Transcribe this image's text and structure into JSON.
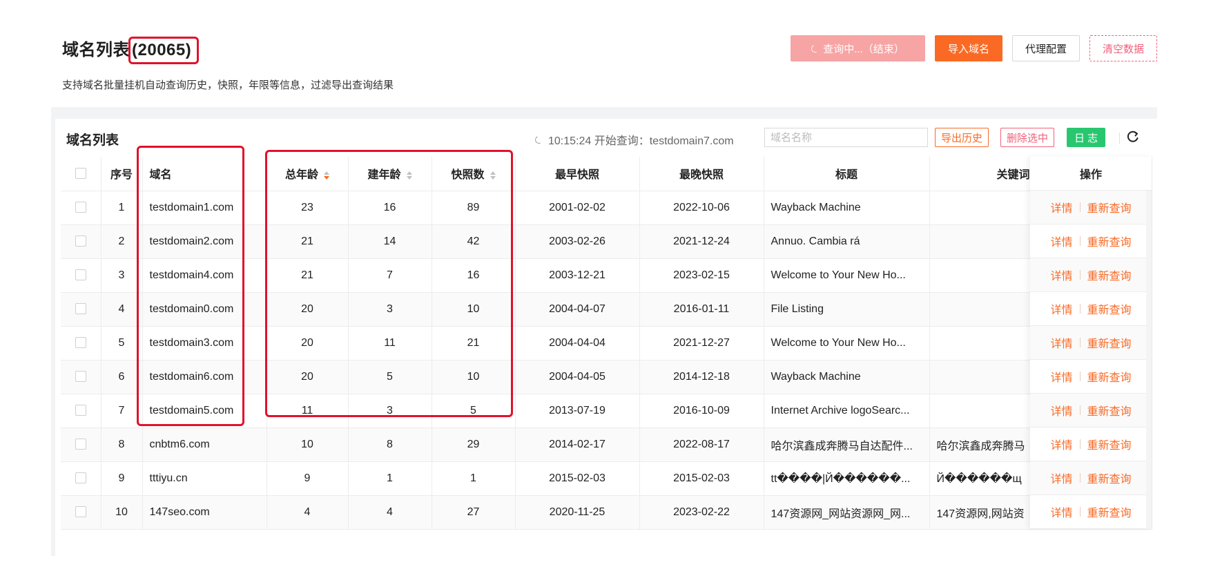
{
  "header": {
    "title": "域名列表",
    "count": "(20065)",
    "description": "支持域名批量挂机自动查询历史，快照，年限等信息，过滤导出查询结果"
  },
  "top_actions": {
    "querying_label": "查询中...（结束）",
    "import_label": "导入域名",
    "proxy_label": "代理配置",
    "clear_label": "清空数据"
  },
  "card": {
    "title": "域名列表",
    "status_text": "10:15:24 开始查询：testdomain7.com",
    "search_placeholder": "域名名称",
    "export_label": "导出历史",
    "delete_label": "删除选中",
    "log_label": "日 志"
  },
  "table": {
    "headers": {
      "index": "序号",
      "domain": "域名",
      "total_age": "总年龄",
      "build_age": "建年龄",
      "snapshots": "快照数",
      "earliest": "最早快照",
      "latest": "最晚快照",
      "title": "标题",
      "keywords": "关键词",
      "actions": "操作"
    },
    "action_labels": {
      "detail": "详情",
      "requery": "重新查询"
    },
    "rows": [
      {
        "index": "1",
        "domain": "testdomain1.com",
        "total_age": "23",
        "build_age": "16",
        "snapshots": "89",
        "earliest": "2001-02-02",
        "latest": "2022-10-06",
        "title": "Wayback Machine",
        "keywords": ""
      },
      {
        "index": "2",
        "domain": "testdomain2.com",
        "total_age": "21",
        "build_age": "14",
        "snapshots": "42",
        "earliest": "2003-02-26",
        "latest": "2021-12-24",
        "title": "Annuo. Cambia rá",
        "keywords": ""
      },
      {
        "index": "3",
        "domain": "testdomain4.com",
        "total_age": "21",
        "build_age": "7",
        "snapshots": "16",
        "earliest": "2003-12-21",
        "latest": "2023-02-15",
        "title": "Welcome to Your New Ho...",
        "keywords": ""
      },
      {
        "index": "4",
        "domain": "testdomain0.com",
        "total_age": "20",
        "build_age": "3",
        "snapshots": "10",
        "earliest": "2004-04-07",
        "latest": "2016-01-11",
        "title": "File Listing",
        "keywords": ""
      },
      {
        "index": "5",
        "domain": "testdomain3.com",
        "total_age": "20",
        "build_age": "11",
        "snapshots": "21",
        "earliest": "2004-04-04",
        "latest": "2021-12-27",
        "title": "Welcome to Your New Ho...",
        "keywords": ""
      },
      {
        "index": "6",
        "domain": "testdomain6.com",
        "total_age": "20",
        "build_age": "5",
        "snapshots": "10",
        "earliest": "2004-04-05",
        "latest": "2014-12-18",
        "title": "Wayback Machine",
        "keywords": ""
      },
      {
        "index": "7",
        "domain": "testdomain5.com",
        "total_age": "11",
        "build_age": "3",
        "snapshots": "5",
        "earliest": "2013-07-19",
        "latest": "2016-10-09",
        "title": "Internet Archive logoSearc...",
        "keywords": ""
      },
      {
        "index": "8",
        "domain": "cnbtm6.com",
        "total_age": "10",
        "build_age": "8",
        "snapshots": "29",
        "earliest": "2014-02-17",
        "latest": "2022-08-17",
        "title": "哈尔滨鑫成奔腾马自达配件...",
        "keywords": "哈尔滨鑫成奔腾马"
      },
      {
        "index": "9",
        "domain": "tttiyu.cn",
        "total_age": "9",
        "build_age": "1",
        "snapshots": "1",
        "earliest": "2015-02-03",
        "latest": "2015-02-03",
        "title": "tt����|Й������...",
        "keywords": "Й������щ"
      },
      {
        "index": "10",
        "domain": "147seo.com",
        "total_age": "4",
        "build_age": "4",
        "snapshots": "27",
        "earliest": "2020-11-25",
        "latest": "2023-02-22",
        "title": "147资源网_网站资源网_网...",
        "keywords": "147资源网,网站资"
      }
    ]
  },
  "colors": {
    "accent_orange": "#fa6a24",
    "danger_pink": "#f0607a",
    "log_green": "#28c76f",
    "highlight_red": "#e0112b"
  },
  "icons": {
    "spinner": "loading-spinner-icon",
    "refresh": "refresh-icon",
    "sort": "sort-caret-icon"
  }
}
